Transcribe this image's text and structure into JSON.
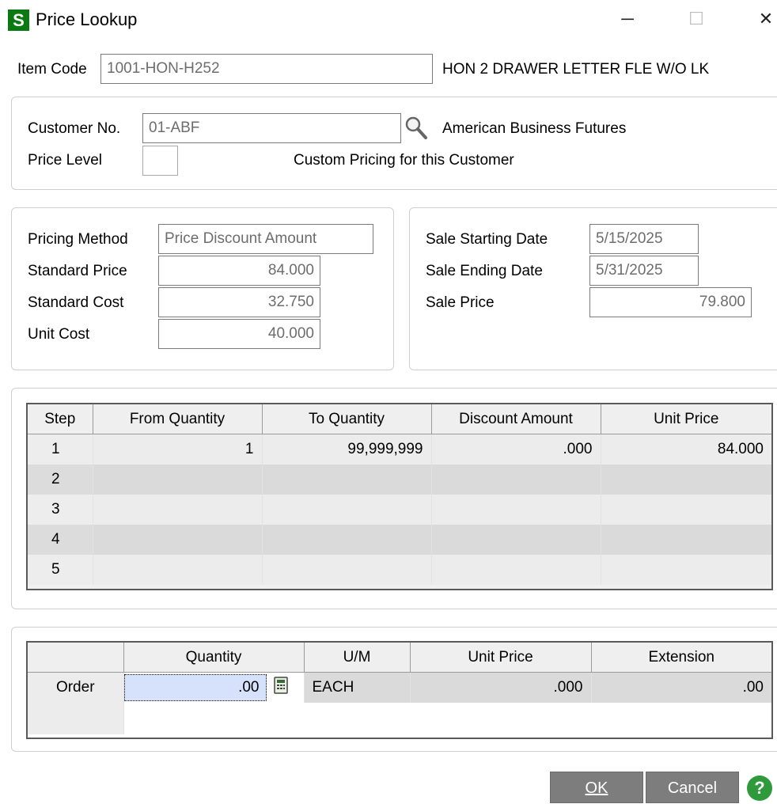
{
  "window": {
    "icon_letter": "S",
    "title": "Price Lookup",
    "min_glyph": "─",
    "max_glyph": "☐",
    "close_glyph": "✕"
  },
  "item": {
    "label": "Item Code",
    "code": "1001-HON-H252",
    "description": "HON 2 DRAWER LETTER FLE W/O LK"
  },
  "customer": {
    "label": "Customer No.",
    "number": "01-ABF",
    "name": "American Business Futures",
    "price_level_label": "Price Level",
    "price_level": "",
    "custom_pricing_text": "Custom Pricing for this Customer"
  },
  "pricing": {
    "method_label": "Pricing Method",
    "method": "Price Discount Amount",
    "standard_price_label": "Standard Price",
    "standard_price": "84.000",
    "standard_cost_label": "Standard Cost",
    "standard_cost": "32.750",
    "unit_cost_label": "Unit Cost",
    "unit_cost": "40.000"
  },
  "sale": {
    "start_label": "Sale Starting Date",
    "start": "5/15/2025",
    "end_label": "Sale Ending Date",
    "end": "5/31/2025",
    "price_label": "Sale Price",
    "price": "79.800"
  },
  "steps_table": {
    "headers": [
      "Step",
      "From Quantity",
      "To Quantity",
      "Discount Amount",
      "Unit Price"
    ],
    "rows": [
      [
        "1",
        "1",
        "99,999,999",
        ".000",
        "84.000"
      ],
      [
        "2",
        "",
        "",
        "",
        ""
      ],
      [
        "3",
        "",
        "",
        "",
        ""
      ],
      [
        "4",
        "",
        "",
        "",
        ""
      ],
      [
        "5",
        "",
        "",
        "",
        ""
      ]
    ]
  },
  "order_table": {
    "headers": [
      "",
      "Quantity",
      "U/M",
      "Unit Price",
      "Extension"
    ],
    "row_label": "Order",
    "quantity": ".00",
    "um": "EACH",
    "unit_price": ".000",
    "extension": ".00"
  },
  "buttons": {
    "ok": "OK",
    "cancel": "Cancel",
    "help": "?"
  }
}
